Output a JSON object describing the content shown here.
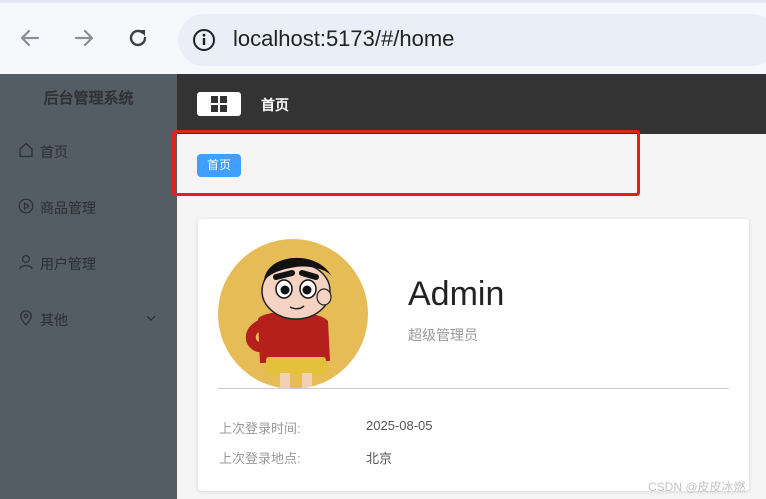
{
  "browser": {
    "url": "localhost:5173/#/home"
  },
  "sidebar": {
    "title": "后台管理系统",
    "items": [
      {
        "label": "首页",
        "icon": "home-icon"
      },
      {
        "label": "商品管理",
        "icon": "play-circle-icon"
      },
      {
        "label": "用户管理",
        "icon": "user-icon"
      },
      {
        "label": "其他",
        "icon": "location-icon"
      }
    ]
  },
  "header": {
    "title": "首页"
  },
  "breadcrumb": {
    "tag": "首页"
  },
  "user": {
    "name": "Admin",
    "role": "超级管理员",
    "last_login_time_label": "上次登录时间:",
    "last_login_time": "2025-08-05",
    "last_login_place_label": "上次登录地点:",
    "last_login_place": "北京"
  },
  "watermark": "CSDN @皮皮冰燃",
  "colors": {
    "sidebar_bg": "#545c64",
    "header_bg": "#333333",
    "tag_blue": "#409eff",
    "highlight_red": "#e32020"
  }
}
